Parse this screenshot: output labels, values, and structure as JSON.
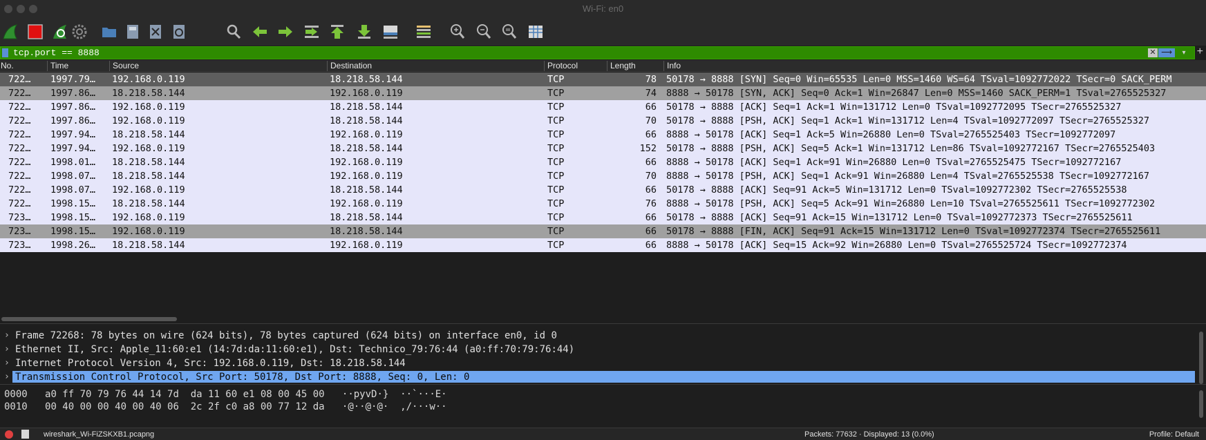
{
  "window": {
    "title": "Wi-Fi: en0"
  },
  "toolbar": {
    "buttons": [
      "start-capture",
      "stop-capture",
      "restart-capture",
      "capture-options",
      "open-file",
      "save-file",
      "close-file",
      "reload-file",
      "find-packet",
      "go-back",
      "go-forward",
      "go-to-packet",
      "go-first",
      "go-last",
      "auto-scroll",
      "colorize",
      "zoom-in",
      "zoom-out",
      "normal-size",
      "resize-columns"
    ]
  },
  "filter": {
    "value": "tcp.port == 8888",
    "clear": "✕",
    "apply": "⟶",
    "dropdown": "▾",
    "add": "+"
  },
  "columns": [
    "No.",
    "Time",
    "Source",
    "Destination",
    "Protocol",
    "Length",
    "Info"
  ],
  "packets": [
    {
      "no": "722…",
      "time": "1997.79…",
      "src": "192.168.0.119",
      "dst": "18.218.58.144",
      "proto": "TCP",
      "len": "78",
      "info": "50178 → 8888 [SYN] Seq=0 Win=65535 Len=0 MSS=1460 WS=64 TSval=1092772022 TSecr=0 SACK_PERM"
    },
    {
      "no": "722…",
      "time": "1997.86…",
      "src": "18.218.58.144",
      "dst": "192.168.0.119",
      "proto": "TCP",
      "len": "74",
      "info": "8888 → 50178 [SYN, ACK] Seq=0 Ack=1 Win=26847 Len=0 MSS=1460 SACK_PERM=1 TSval=2765525327"
    },
    {
      "no": "722…",
      "time": "1997.86…",
      "src": "192.168.0.119",
      "dst": "18.218.58.144",
      "proto": "TCP",
      "len": "66",
      "info": "50178 → 8888 [ACK] Seq=1 Ack=1 Win=131712 Len=0 TSval=1092772095 TSecr=2765525327"
    },
    {
      "no": "722…",
      "time": "1997.86…",
      "src": "192.168.0.119",
      "dst": "18.218.58.144",
      "proto": "TCP",
      "len": "70",
      "info": "50178 → 8888 [PSH, ACK] Seq=1 Ack=1 Win=131712 Len=4 TSval=1092772097 TSecr=2765525327"
    },
    {
      "no": "722…",
      "time": "1997.94…",
      "src": "18.218.58.144",
      "dst": "192.168.0.119",
      "proto": "TCP",
      "len": "66",
      "info": "8888 → 50178 [ACK] Seq=1 Ack=5 Win=26880 Len=0 TSval=2765525403 TSecr=1092772097"
    },
    {
      "no": "722…",
      "time": "1997.94…",
      "src": "192.168.0.119",
      "dst": "18.218.58.144",
      "proto": "TCP",
      "len": "152",
      "info": "50178 → 8888 [PSH, ACK] Seq=5 Ack=1 Win=131712 Len=86 TSval=1092772167 TSecr=2765525403"
    },
    {
      "no": "722…",
      "time": "1998.01…",
      "src": "18.218.58.144",
      "dst": "192.168.0.119",
      "proto": "TCP",
      "len": "66",
      "info": "8888 → 50178 [ACK] Seq=1 Ack=91 Win=26880 Len=0 TSval=2765525475 TSecr=1092772167"
    },
    {
      "no": "722…",
      "time": "1998.07…",
      "src": "18.218.58.144",
      "dst": "192.168.0.119",
      "proto": "TCP",
      "len": "70",
      "info": "8888 → 50178 [PSH, ACK] Seq=1 Ack=91 Win=26880 Len=4 TSval=2765525538 TSecr=1092772167"
    },
    {
      "no": "722…",
      "time": "1998.07…",
      "src": "192.168.0.119",
      "dst": "18.218.58.144",
      "proto": "TCP",
      "len": "66",
      "info": "50178 → 8888 [ACK] Seq=91 Ack=5 Win=131712 Len=0 TSval=1092772302 TSecr=2765525538"
    },
    {
      "no": "722…",
      "time": "1998.15…",
      "src": "18.218.58.144",
      "dst": "192.168.0.119",
      "proto": "TCP",
      "len": "76",
      "info": "8888 → 50178 [PSH, ACK] Seq=5 Ack=91 Win=26880 Len=10 TSval=2765525611 TSecr=1092772302"
    },
    {
      "no": "723…",
      "time": "1998.15…",
      "src": "192.168.0.119",
      "dst": "18.218.58.144",
      "proto": "TCP",
      "len": "66",
      "info": "50178 → 8888 [ACK] Seq=91 Ack=15 Win=131712 Len=0 TSval=1092772373 TSecr=2765525611"
    },
    {
      "no": "723…",
      "time": "1998.15…",
      "src": "192.168.0.119",
      "dst": "18.218.58.144",
      "proto": "TCP",
      "len": "66",
      "info": "50178 → 8888 [FIN, ACK] Seq=91 Ack=15 Win=131712 Len=0 TSval=1092772374 TSecr=2765525611"
    },
    {
      "no": "723…",
      "time": "1998.26…",
      "src": "18.218.58.144",
      "dst": "192.168.0.119",
      "proto": "TCP",
      "len": "66",
      "info": "8888 → 50178 [ACK] Seq=15 Ack=92 Win=26880 Len=0 TSval=2765525724 TSecr=1092772374"
    }
  ],
  "details": [
    "Frame 72268: 78 bytes on wire (624 bits), 78 bytes captured (624 bits) on interface en0, id 0",
    "Ethernet II, Src: Apple_11:60:e1 (14:7d:da:11:60:e1), Dst: Technico_79:76:44 (a0:ff:70:79:76:44)",
    "Internet Protocol Version 4, Src: 192.168.0.119, Dst: 18.218.58.144",
    "Transmission Control Protocol, Src Port: 50178, Dst Port: 8888, Seq: 0, Len: 0"
  ],
  "bytes": [
    {
      "offset": "0000",
      "hex": "a0 ff 70 79 76 44 14 7d  da 11 60 e1 08 00 45 00",
      "ascii": "··pyvD·}  ··`···E·"
    },
    {
      "offset": "0010",
      "hex": "00 40 00 00 40 00 40 06  2c 2f c0 a8 00 77 12 da",
      "ascii": "·@··@·@·  ,/···w··"
    }
  ],
  "status": {
    "file": "wireshark_Wi-FiZSKXB1.pcapng",
    "packets": "Packets: 77632 · Displayed: 13 (0.0%)",
    "profile": "Profile: Default"
  },
  "colors": {
    "filter_valid": "#2e8b00",
    "row_tcp": "#e6e6fa",
    "row_selected": "#5e5e5e",
    "row_marked": "#a0a0a0",
    "detail_selected": "#6fa6f0"
  }
}
